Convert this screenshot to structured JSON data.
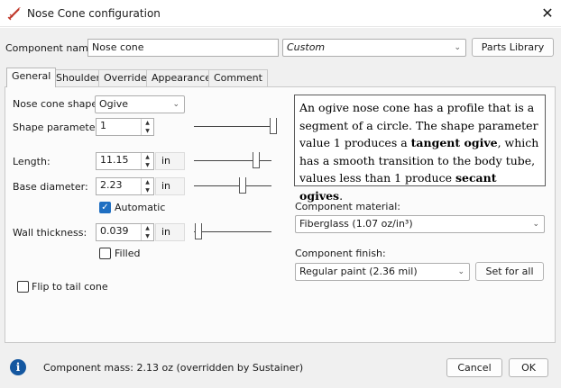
{
  "window": {
    "title": "Nose Cone configuration",
    "close": "✕"
  },
  "top": {
    "name_label": "Component name:",
    "name_value": "Nose cone",
    "preset_value": "Custom",
    "parts_library": "Parts Library"
  },
  "tabs": [
    {
      "label": "General",
      "active": true
    },
    {
      "label": "Shoulder"
    },
    {
      "label": "Override"
    },
    {
      "label": "Appearance"
    },
    {
      "label": "Comment"
    }
  ],
  "general": {
    "shape_label": "Nose cone shape:",
    "shape_value": "Ogive",
    "shape_param_label": "Shape parameter:",
    "shape_param_value": "1",
    "length_label": "Length:",
    "length_value": "11.15",
    "length_unit": "in",
    "base_label": "Base diameter:",
    "base_value": "2.23",
    "base_unit": "in",
    "automatic_label": "Automatic",
    "automatic_checked": true,
    "wall_label": "Wall thickness:",
    "wall_value": "0.039",
    "wall_unit": "in",
    "filled_label": "Filled",
    "filled_checked": false,
    "flip_label": "Flip to tail cone",
    "flip_checked": false
  },
  "description": {
    "p1": "An ogive nose cone has a profile that is a segment of a circle. The shape parameter value 1 produces a ",
    "b1": "tangent ogive",
    "p2": ", which has a smooth transition to the body tube, values less than 1 produce ",
    "b2": "secant ogives",
    "p3": "."
  },
  "material": {
    "label": "Component material:",
    "value": "Fiberglass (1.07 oz/in³)"
  },
  "finish": {
    "label": "Component finish:",
    "value": "Regular paint (2.36 mil)",
    "set_all": "Set for all"
  },
  "footer": {
    "mass_text": "Component mass: 2.13 oz (overridden by Sustainer)",
    "cancel": "Cancel",
    "ok": "OK"
  },
  "icons": {
    "app": "rocket-icon",
    "info": "info-icon",
    "spinner_up": "▲",
    "spinner_down": "▼",
    "chevron": "⌄",
    "check": "✓"
  }
}
